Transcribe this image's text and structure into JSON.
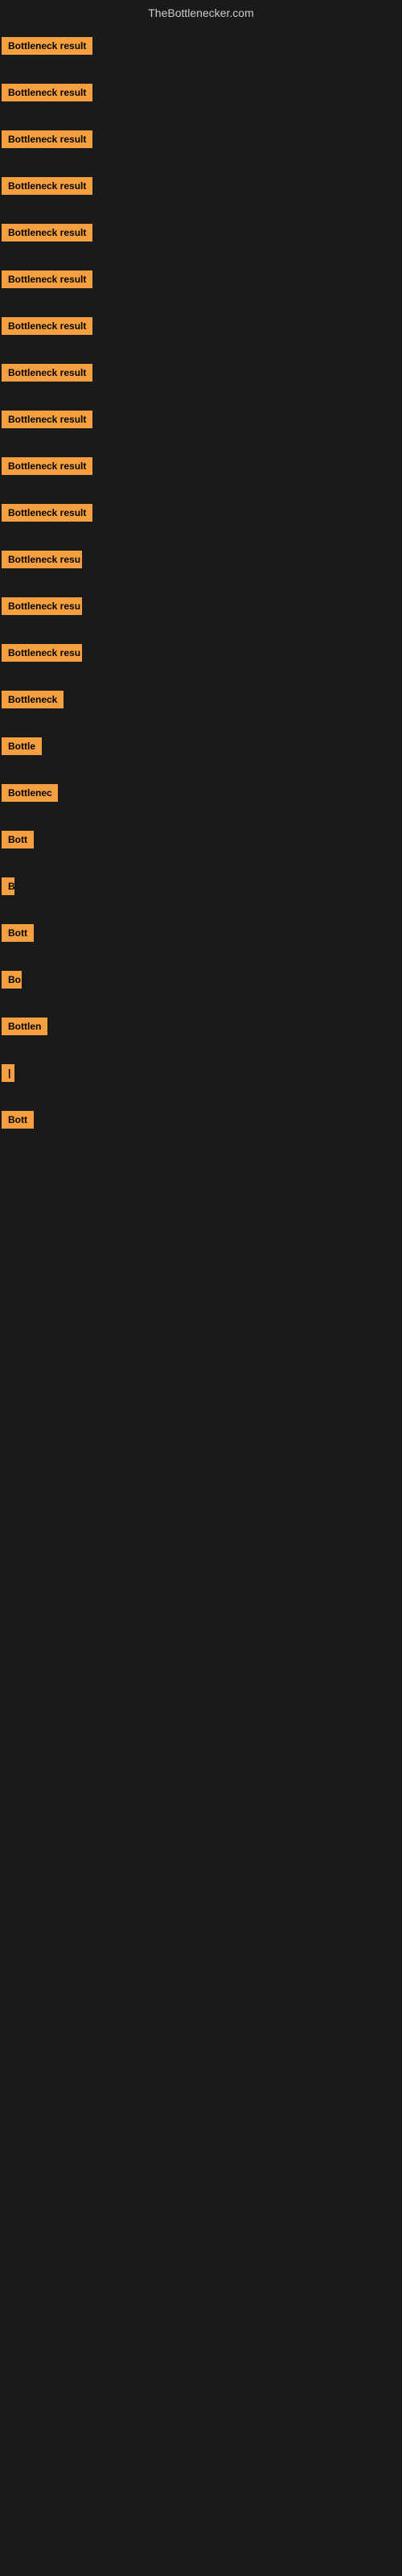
{
  "site": {
    "title": "TheBottlenecker.com"
  },
  "items": [
    {
      "label": "Bottleneck result",
      "width": 115,
      "truncated": false
    },
    {
      "label": "Bottleneck result",
      "width": 115,
      "truncated": false
    },
    {
      "label": "Bottleneck result",
      "width": 115,
      "truncated": false
    },
    {
      "label": "Bottleneck result",
      "width": 115,
      "truncated": false
    },
    {
      "label": "Bottleneck result",
      "width": 115,
      "truncated": false
    },
    {
      "label": "Bottleneck result",
      "width": 115,
      "truncated": false
    },
    {
      "label": "Bottleneck result",
      "width": 115,
      "truncated": false
    },
    {
      "label": "Bottleneck result",
      "width": 115,
      "truncated": false
    },
    {
      "label": "Bottleneck result",
      "width": 115,
      "truncated": false
    },
    {
      "label": "Bottleneck result",
      "width": 115,
      "truncated": false
    },
    {
      "label": "Bottleneck result",
      "width": 115,
      "truncated": false
    },
    {
      "label": "Bottleneck resu",
      "width": 100,
      "truncated": true
    },
    {
      "label": "Bottleneck resu",
      "width": 100,
      "truncated": true
    },
    {
      "label": "Bottleneck resu",
      "width": 100,
      "truncated": true
    },
    {
      "label": "Bottleneck",
      "width": 80,
      "truncated": true
    },
    {
      "label": "Bottle",
      "width": 55,
      "truncated": true
    },
    {
      "label": "Bottlenec",
      "width": 70,
      "truncated": true
    },
    {
      "label": "Bott",
      "width": 40,
      "truncated": true
    },
    {
      "label": "B",
      "width": 15,
      "truncated": true
    },
    {
      "label": "Bott",
      "width": 40,
      "truncated": true
    },
    {
      "label": "Bo",
      "width": 25,
      "truncated": true
    },
    {
      "label": "Bottlen",
      "width": 58,
      "truncated": true
    },
    {
      "label": "|",
      "width": 8,
      "truncated": true
    },
    {
      "label": "Bott",
      "width": 40,
      "truncated": true
    }
  ]
}
